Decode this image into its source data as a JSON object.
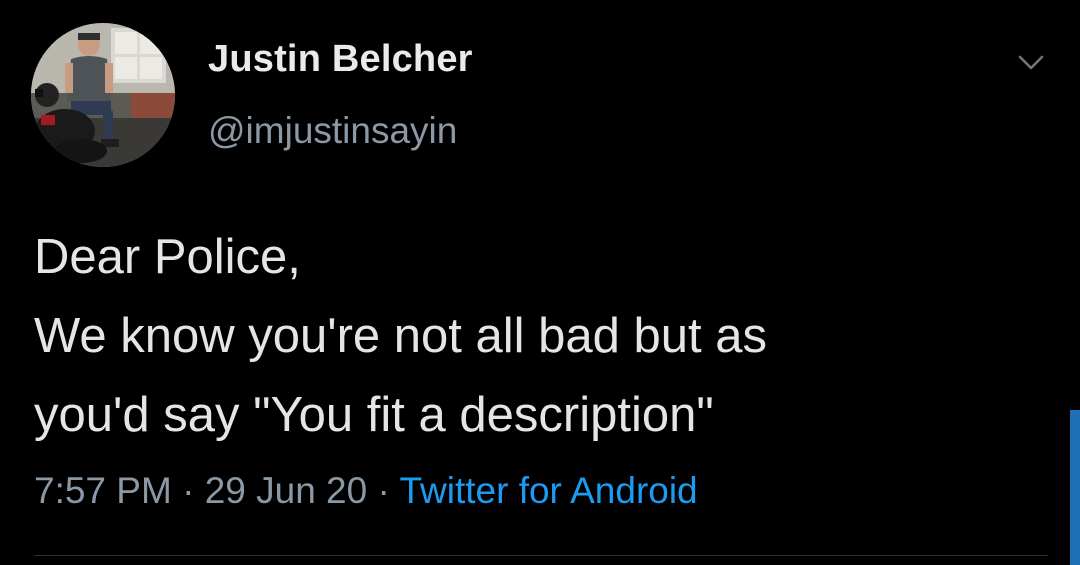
{
  "tweet": {
    "display_name": "Justin Belcher",
    "handle": "@imjustinsayin",
    "body_lines": [
      "Dear Police,",
      "We know you're not all bad but as",
      "you'd say \"You fit a description\""
    ],
    "time": "7:57 PM",
    "separator": "·",
    "date": "29 Jun 20",
    "source": "Twitter for Android"
  },
  "icons": {
    "menu": "chevron-down-icon",
    "avatar": "avatar"
  },
  "colors": {
    "background": "#000000",
    "text": "#e3e5e7",
    "secondary_text": "#8b98a5",
    "link": "#1d9bf0",
    "divider": "#2f3336"
  }
}
